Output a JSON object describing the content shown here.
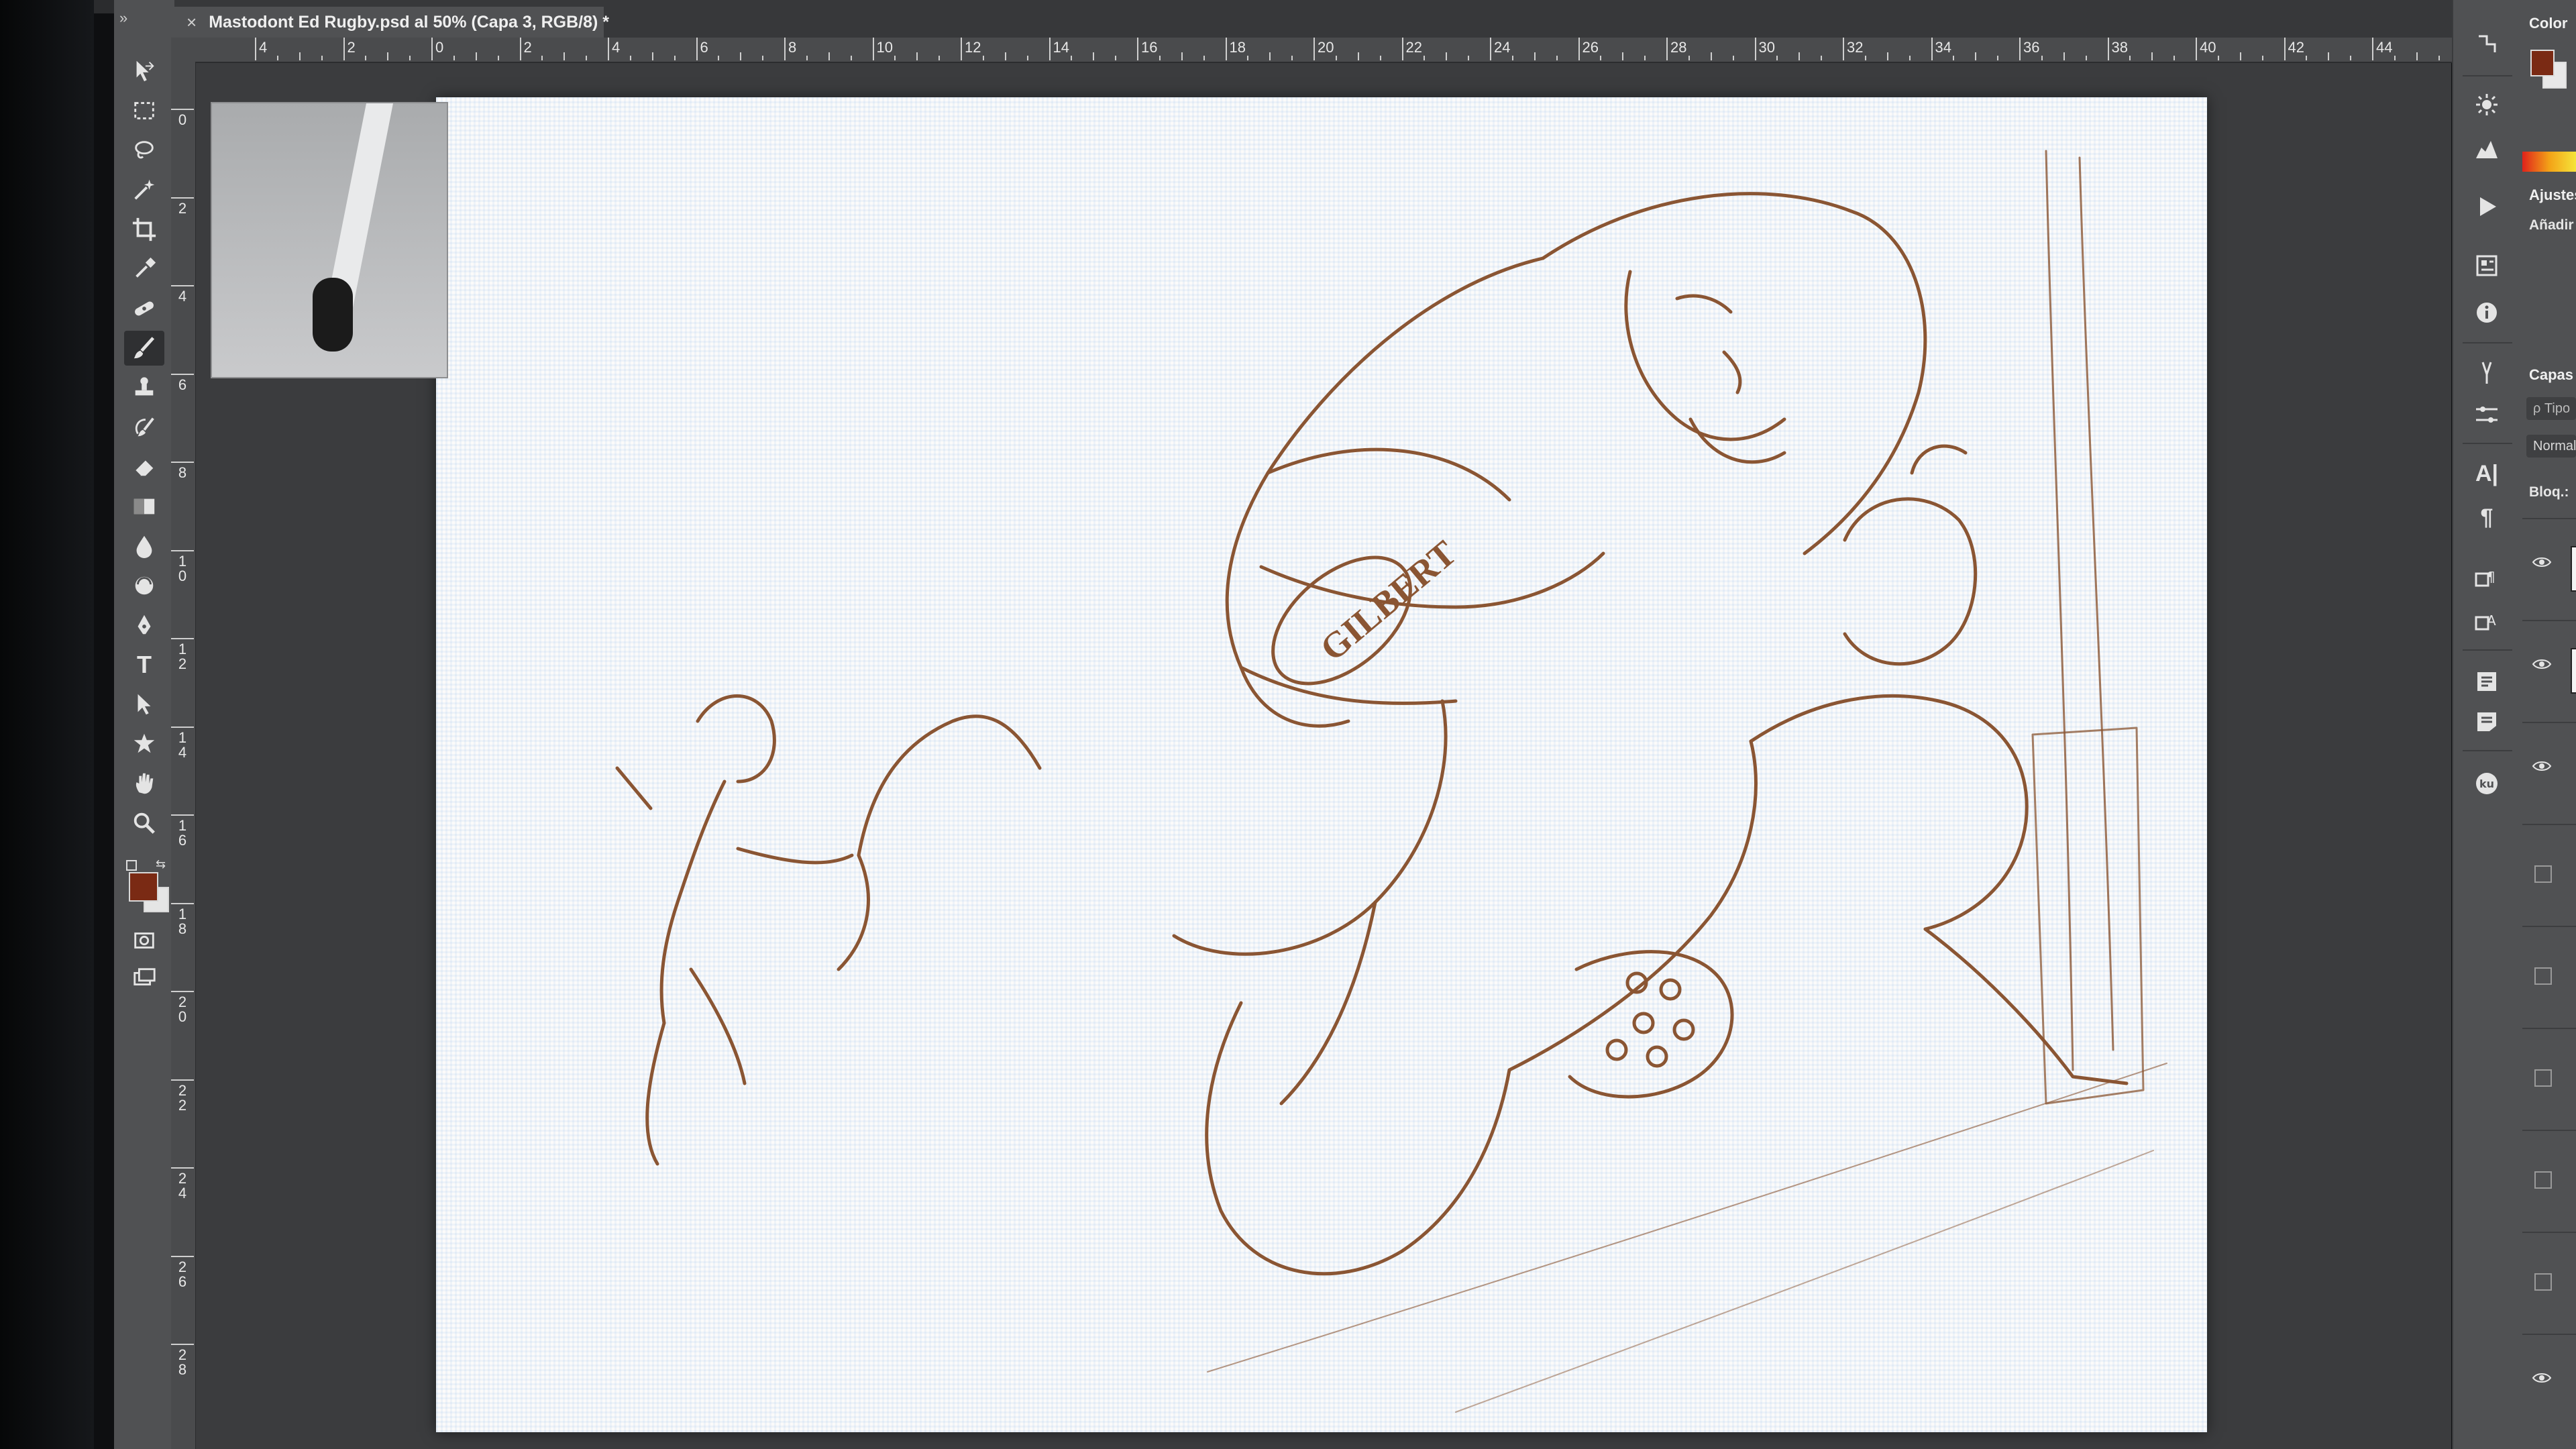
{
  "document": {
    "title": "Mastodont Ed Rugby.psd al 50% (Capa 3, RGB/8) *",
    "close_glyph": "×"
  },
  "toolbar": {
    "collapse_glyph": "»",
    "tools": [
      {
        "name": "move-tool",
        "icon": "move-icon"
      },
      {
        "name": "marquee-tool",
        "icon": "marquee-icon"
      },
      {
        "name": "lasso-tool",
        "icon": "lasso-icon"
      },
      {
        "name": "magic-wand-tool",
        "icon": "magic-wand-icon"
      },
      {
        "name": "crop-tool",
        "icon": "crop-icon"
      },
      {
        "name": "eyedropper-tool",
        "icon": "eyedropper-icon"
      },
      {
        "name": "healing-brush-tool",
        "icon": "bandage-icon"
      },
      {
        "name": "brush-tool",
        "icon": "brush-icon",
        "active": true
      },
      {
        "name": "clone-stamp-tool",
        "icon": "stamp-icon"
      },
      {
        "name": "history-brush-tool",
        "icon": "history-brush-icon"
      },
      {
        "name": "eraser-tool",
        "icon": "eraser-icon"
      },
      {
        "name": "gradient-tool",
        "icon": "gradient-icon"
      },
      {
        "name": "blur-tool",
        "icon": "droplet-icon"
      },
      {
        "name": "dodge-tool",
        "icon": "dodge-icon"
      },
      {
        "name": "pen-tool",
        "icon": "pen-icon"
      },
      {
        "name": "type-tool",
        "icon": "type-icon",
        "glyph": "T"
      },
      {
        "name": "path-selection-tool",
        "icon": "arrow-icon"
      },
      {
        "name": "custom-shape-tool",
        "icon": "shape-icon"
      },
      {
        "name": "hand-tool",
        "icon": "hand-icon"
      },
      {
        "name": "zoom-tool",
        "icon": "zoom-icon"
      }
    ],
    "foreground_color": "#7a2a14",
    "background_color": "#e5e5e5"
  },
  "rulers": {
    "horizontal": [
      "4",
      "2",
      "0",
      "2",
      "4",
      "6",
      "8",
      "10",
      "12",
      "14",
      "16",
      "18",
      "20",
      "22",
      "24",
      "26",
      "28",
      "30",
      "32",
      "34",
      "36",
      "38",
      "40",
      "42",
      "44"
    ],
    "vertical": [
      "0",
      "2",
      "4",
      "6",
      "8",
      "10",
      "12",
      "14",
      "16",
      "18",
      "20",
      "22",
      "24",
      "26",
      "28"
    ]
  },
  "panels": {
    "color_title": "Color",
    "adjustments_title": "Ajustes",
    "adjustments_add": "Añadir",
    "layers_title": "Capas",
    "layers_search": "ρ Tipo",
    "blend_mode": "Normal",
    "lock_label": "Bloq.:",
    "layer_rows": [
      {
        "visible": true
      },
      {
        "visible": true
      },
      {
        "visible": true
      },
      {
        "visible": false
      },
      {
        "visible": false
      },
      {
        "visible": false
      },
      {
        "visible": false
      },
      {
        "visible": false
      },
      {
        "visible": true
      }
    ]
  },
  "artwork": {
    "ball_text": "GILBERT",
    "line_color": "#8a5533"
  }
}
